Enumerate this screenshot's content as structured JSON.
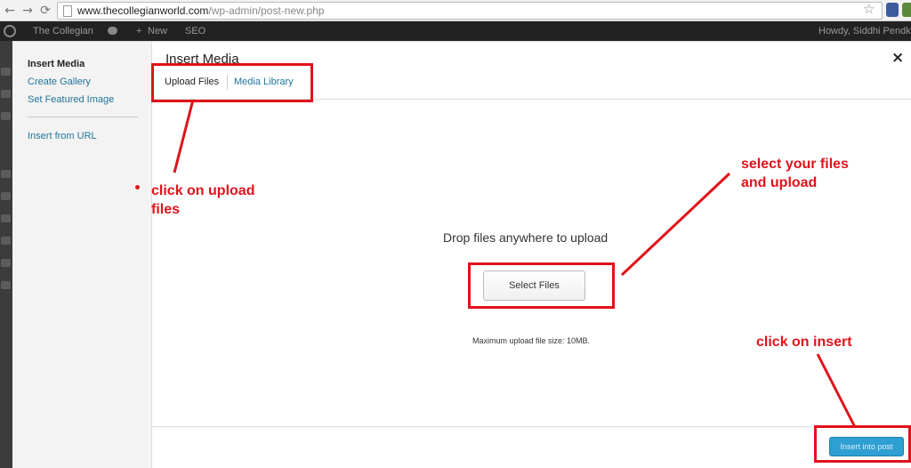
{
  "browser": {
    "url_host": "www.thecollegianworld.com",
    "url_path": "/wp-admin/post-new.php",
    "back_icon": "back-arrow-icon",
    "forward_icon": "forward-arrow-icon",
    "reload_icon": "reload-icon",
    "bookmark_icon": "star-icon"
  },
  "admin_bar": {
    "site_name": "The Collegian",
    "new_label": "New",
    "seo_label": "SEO",
    "greeting": "Howdy, Siddhi Pendke"
  },
  "modal": {
    "title": "Insert Media",
    "close_glyph": "×",
    "menu": [
      {
        "label": "Insert Media",
        "active": true
      },
      {
        "label": "Create Gallery",
        "active": false
      },
      {
        "label": "Set Featured Image",
        "active": false
      },
      {
        "label": "Insert from URL",
        "active": false
      }
    ],
    "tabs": [
      {
        "label": "Upload Files",
        "active": true
      },
      {
        "label": "Media Library",
        "active": false
      }
    ],
    "uploader": {
      "drop_title": "Drop files anywhere to upload",
      "select_button": "Select Files",
      "max_size": "Maximum upload file size: 10MB."
    },
    "insert_button": "Insert into post"
  },
  "annotations": {
    "upload_note": [
      "click on upload",
      "files"
    ],
    "select_note": [
      "select your files",
      "and upload"
    ],
    "insert_note": "click on insert"
  },
  "colors": {
    "annotation": "#e0131a",
    "primary_button": "#2e9fd2",
    "link": "#21759b",
    "admin_bar": "#222222"
  }
}
